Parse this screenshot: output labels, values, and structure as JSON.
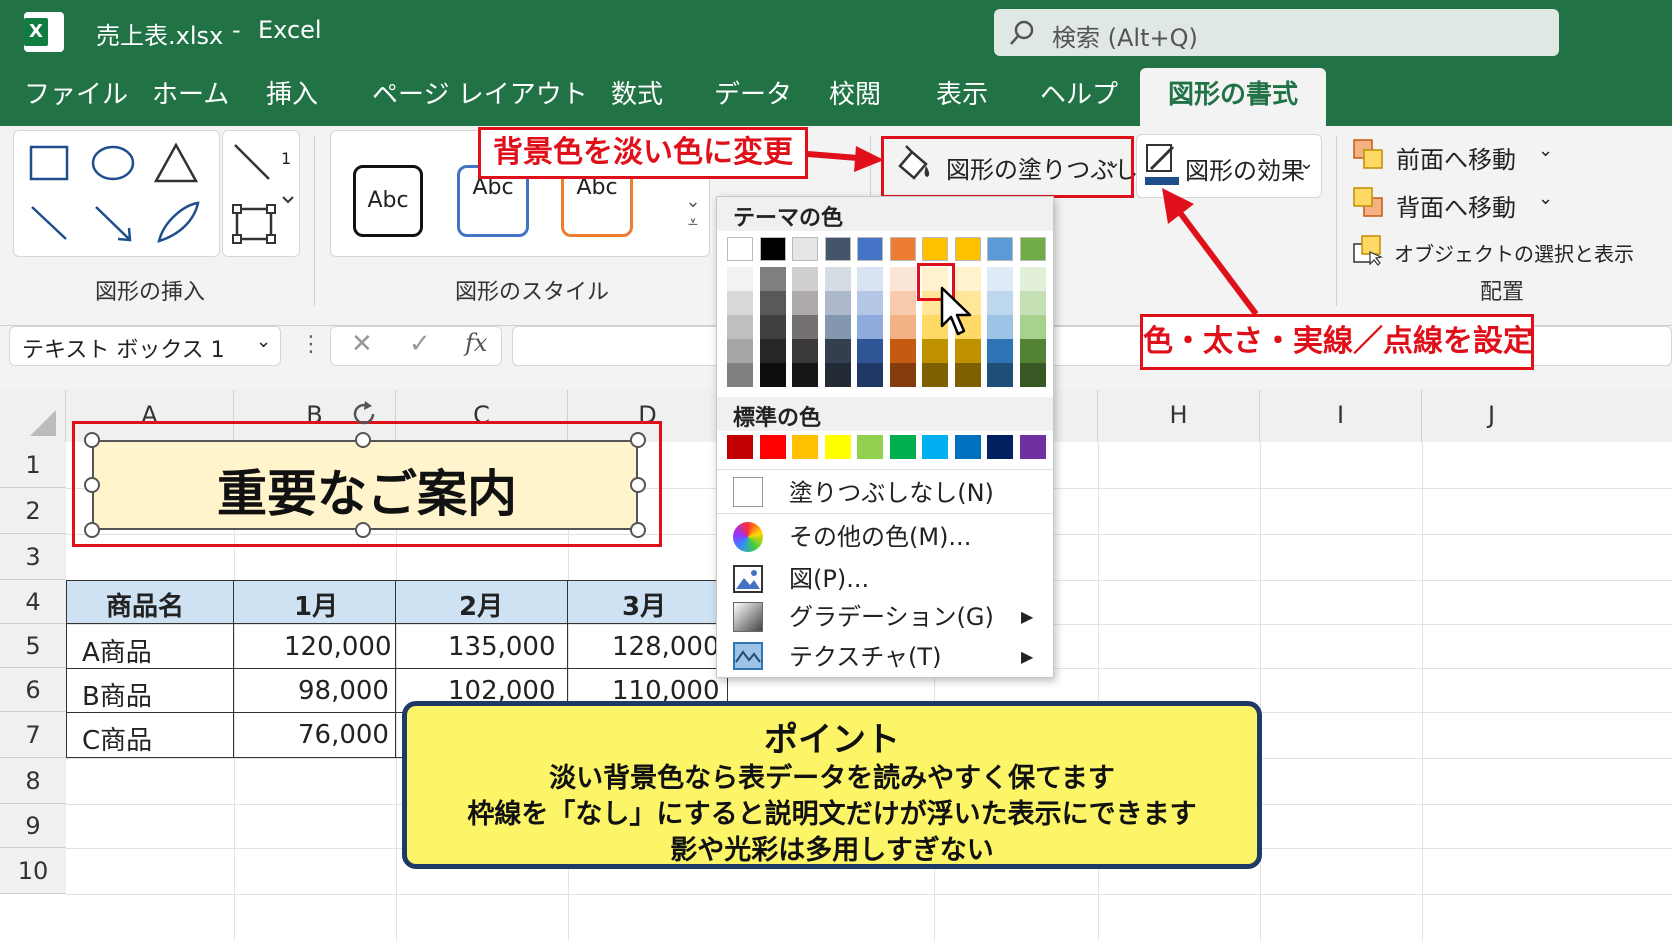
{
  "app": {
    "file_title": "売上表.xlsx",
    "separator": "-",
    "app_name": "Excel",
    "search_placeholder": "検索 (Alt+Q)"
  },
  "tabs": [
    "ファイル",
    "ホーム",
    "挿入",
    "ページ レイアウト",
    "数式",
    "データ",
    "校閲",
    "表示",
    "ヘルプ",
    "図形の書式"
  ],
  "ribbon": {
    "insert_group_label": "図形の挿入",
    "style_group_label": "図形のスタイル",
    "style_samples": [
      "Abc",
      "Abc",
      "Abc"
    ],
    "fill_button": "図形の塗りつぶし",
    "effect_button": "図形の効果",
    "bring_forward": "前面へ移動",
    "send_backward": "背面へ移動",
    "selection_pane": "オブジェクトの選択と表示",
    "arrange_label": "配置",
    "shape_count_badge": "1"
  },
  "annotations": {
    "fill_note": "背景色を淡い色に変更",
    "outline_note": "色・太さ・実線／点線を設定"
  },
  "formula_bar": {
    "name_box": "テキスト ボックス 1",
    "fx": "fx"
  },
  "columns": [
    "A",
    "B",
    "C",
    "D",
    "H",
    "I",
    "J"
  ],
  "rows": [
    "1",
    "2",
    "3",
    "4",
    "5",
    "6",
    "7",
    "8",
    "9",
    "10"
  ],
  "shape_text": "重要なご案内",
  "table": {
    "headers": [
      "商品名",
      "1月",
      "2月",
      "3月"
    ],
    "rows": [
      [
        "A商品",
        "120,000",
        "135,000",
        "128,000"
      ],
      [
        "B商品",
        "98,000",
        "102,000",
        "110,000"
      ],
      [
        "C商品",
        "76,000",
        "",
        ""
      ]
    ]
  },
  "dropdown": {
    "theme_title": "テーマの色",
    "standard_title": "標準の色",
    "no_fill": "塗りつぶしなし(N)",
    "more_colors": "その他の色(M)...",
    "picture": "図(P)...",
    "gradient": "グラデーション(G)",
    "texture": "テクスチャ(T)",
    "theme_colors": [
      "#ffffff",
      "#000000",
      "#e7e6e6",
      "#44546a",
      "#4472c4",
      "#ed7d31",
      "#ffc000",
      "#ffc000",
      "#5b9bd5",
      "#70ad47"
    ],
    "theme_tints": [
      [
        "#f2f2f2",
        "#d9d9d9",
        "#bfbfbf",
        "#a6a6a6",
        "#808080"
      ],
      [
        "#7f7f7f",
        "#595959",
        "#404040",
        "#262626",
        "#0d0d0d"
      ],
      [
        "#d0cece",
        "#aeaaaa",
        "#767171",
        "#3b3838",
        "#171616"
      ],
      [
        "#d6dce4",
        "#adb9ca",
        "#8497b0",
        "#333f4f",
        "#222a35"
      ],
      [
        "#dae3f3",
        "#b4c7e7",
        "#8faadc",
        "#2f5597",
        "#1f3864"
      ],
      [
        "#fbe5d6",
        "#f8cbad",
        "#f4b183",
        "#c55a11",
        "#843c0c"
      ],
      [
        "#fff2cc",
        "#ffe699",
        "#ffd966",
        "#bf9000",
        "#7f6000"
      ],
      [
        "#fff2cc",
        "#ffe699",
        "#ffd966",
        "#bf9000",
        "#7f6000"
      ],
      [
        "#deebf7",
        "#bdd7ee",
        "#9dc3e6",
        "#2e75b6",
        "#1f4e79"
      ],
      [
        "#e2f0d9",
        "#c5e0b4",
        "#a9d18e",
        "#548235",
        "#385723"
      ]
    ],
    "standard_colors": [
      "#c00000",
      "#ff0000",
      "#ffc000",
      "#ffff00",
      "#92d050",
      "#00b050",
      "#00b0f0",
      "#0070c0",
      "#002060",
      "#7030a0"
    ]
  },
  "point_box": {
    "title": "ポイント",
    "lines": [
      "淡い背景色なら表データを読みやすく保てます",
      "枠線を「なし」にすると説明文だけが浮いた表示にできます",
      "影や光彩は多用しすぎない"
    ]
  }
}
